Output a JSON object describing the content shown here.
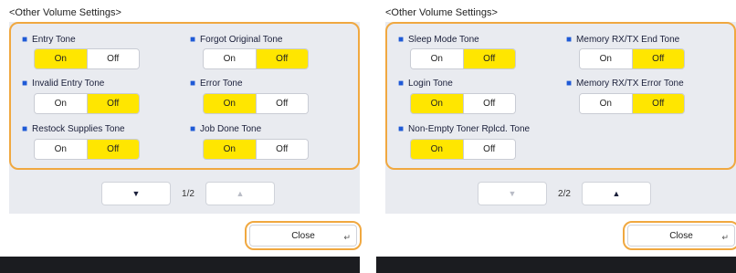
{
  "colors": {
    "highlight": "#ffe600",
    "focus_border": "#f0a840",
    "bullet": "#1f5ad6",
    "panel_bg": "#e9ebf0"
  },
  "left": {
    "title": "<Other Volume Settings>",
    "items": [
      {
        "label": "Entry Tone",
        "on": "On",
        "off": "Off",
        "selected": "on"
      },
      {
        "label": "Forgot Original Tone",
        "on": "On",
        "off": "Off",
        "selected": "off"
      },
      {
        "label": "Invalid Entry Tone",
        "on": "On",
        "off": "Off",
        "selected": "off"
      },
      {
        "label": "Error Tone",
        "on": "On",
        "off": "Off",
        "selected": "on"
      },
      {
        "label": "Restock Supplies Tone",
        "on": "On",
        "off": "Off",
        "selected": "off"
      },
      {
        "label": "Job Done Tone",
        "on": "On",
        "off": "Off",
        "selected": "on"
      }
    ],
    "nav": {
      "down_icon": "▼",
      "page": "1/2",
      "up_icon": "▲",
      "down_enabled": true,
      "up_enabled": false
    },
    "close_label": "Close",
    "enter_icon": "↵"
  },
  "right": {
    "title": "<Other Volume Settings>",
    "items": [
      {
        "label": "Sleep Mode Tone",
        "on": "On",
        "off": "Off",
        "selected": "off"
      },
      {
        "label": "Memory RX/TX End Tone",
        "on": "On",
        "off": "Off",
        "selected": "off"
      },
      {
        "label": "Login Tone",
        "on": "On",
        "off": "Off",
        "selected": "on"
      },
      {
        "label": "Memory RX/TX Error Tone",
        "on": "On",
        "off": "Off",
        "selected": "off"
      },
      {
        "label": "Non-Empty Toner Rplcd. Tone",
        "on": "On",
        "off": "Off",
        "selected": "on"
      }
    ],
    "nav": {
      "down_icon": "▼",
      "page": "2/2",
      "up_icon": "▲",
      "down_enabled": false,
      "up_enabled": true
    },
    "close_label": "Close",
    "enter_icon": "↵"
  }
}
